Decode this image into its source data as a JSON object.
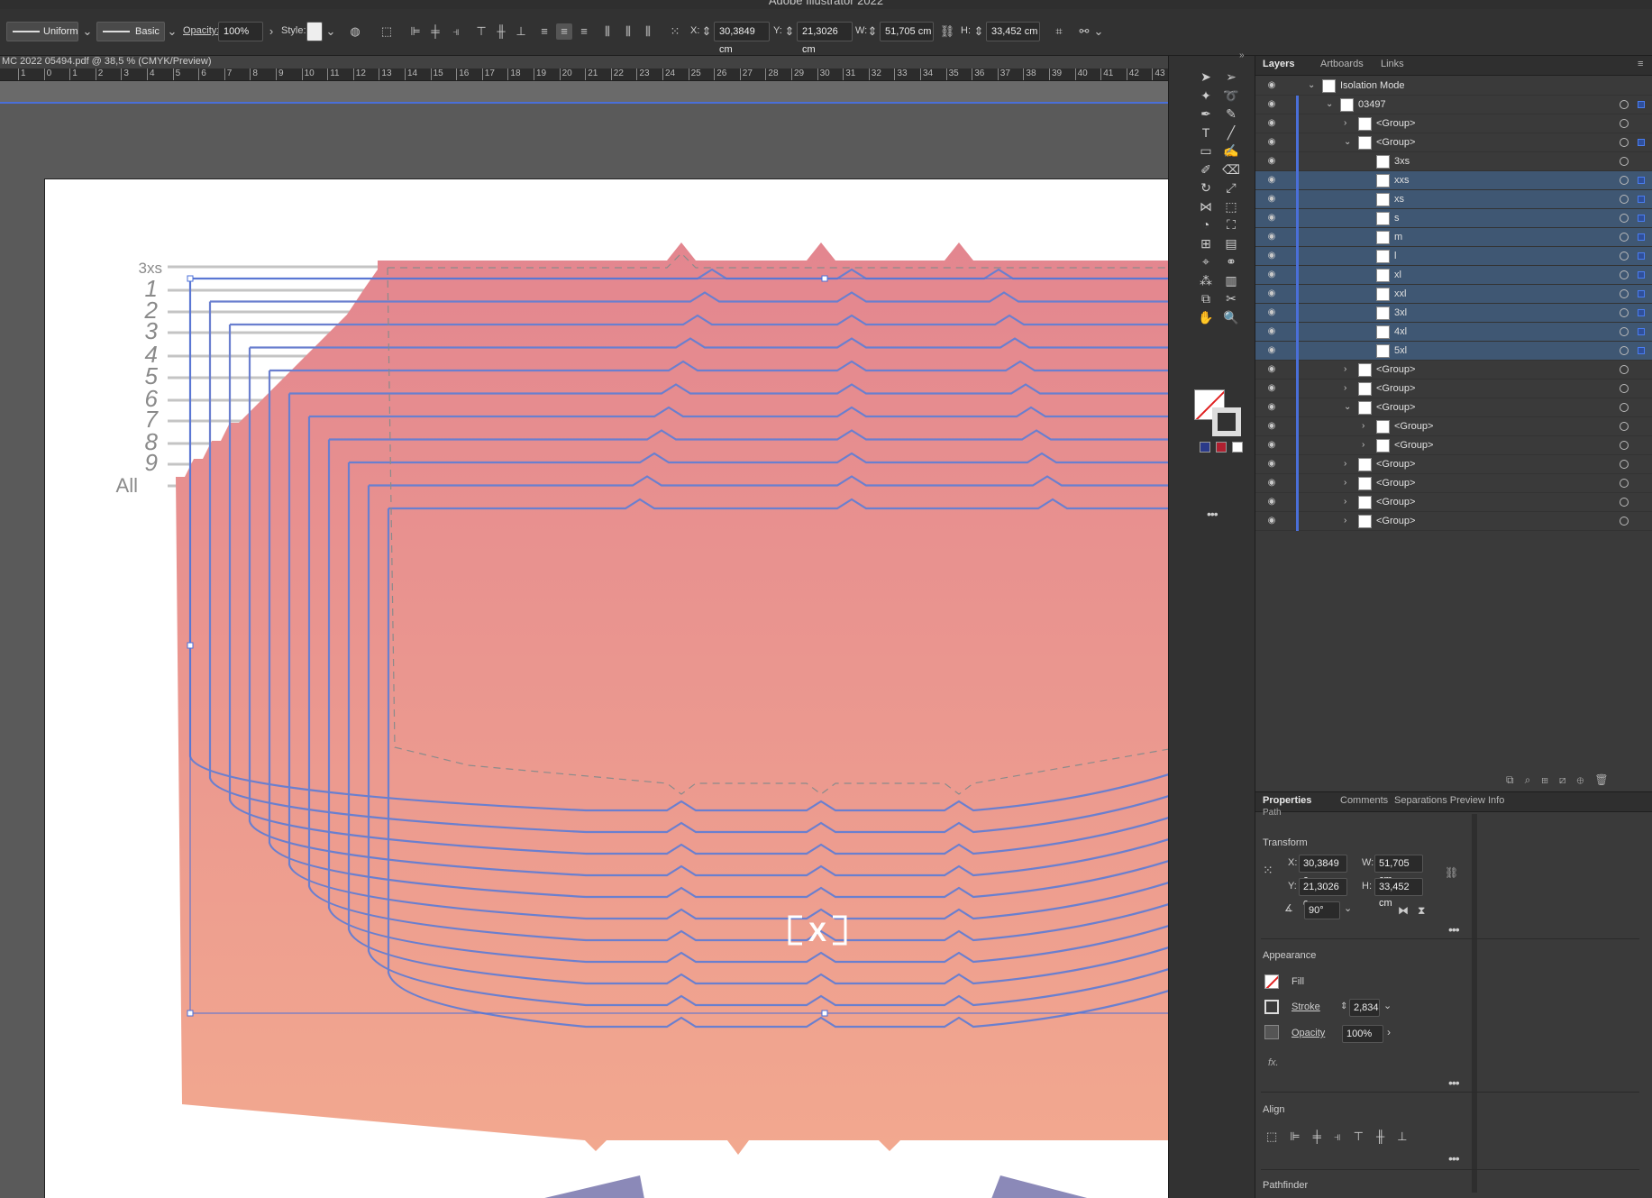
{
  "app": {
    "title": "Adobe Illustrator 2022"
  },
  "control_bar": {
    "stroke_profile": "Uniform",
    "brush": "Basic",
    "opacity_label": "Opacity:",
    "opacity_value": "100%",
    "style_label": "Style:",
    "x_label": "X:",
    "x_value": "30,3849 cm",
    "y_label": "Y:",
    "y_value": "21,3026 cm",
    "w_label": "W:",
    "w_value": "51,705 cm",
    "h_label": "H:",
    "h_value": "33,452 cm"
  },
  "document": {
    "tab_title": "MC 2022 05494.pdf @ 38,5 % (CMYK/Preview)",
    "ruler_ticks": [
      "1",
      "0",
      "1",
      "2",
      "3",
      "4",
      "5",
      "6",
      "7",
      "8",
      "9",
      "10",
      "11",
      "12",
      "13",
      "14",
      "15",
      "16",
      "17",
      "18",
      "19",
      "20",
      "21",
      "22",
      "23",
      "24",
      "25",
      "26",
      "27",
      "28",
      "29",
      "30",
      "31",
      "32",
      "33",
      "34",
      "35",
      "36",
      "37",
      "38",
      "39",
      "40",
      "41",
      "42",
      "43"
    ],
    "size_labels": [
      "3xs",
      "1",
      "2",
      "3",
      "4",
      "5",
      "6",
      "7",
      "8",
      "9",
      "All"
    ],
    "badge": "[X]"
  },
  "layers_panel": {
    "tabs": [
      "Layers",
      "Artboards",
      "Links"
    ],
    "rows": [
      {
        "name": "Isolation Mode",
        "indent": 0,
        "chev": "v",
        "sel": false
      },
      {
        "name": "03497",
        "indent": 1,
        "chev": "v",
        "sel": false
      },
      {
        "name": "<Group>",
        "indent": 2,
        "chev": ">",
        "sel": false
      },
      {
        "name": "<Group>",
        "indent": 2,
        "chev": "v",
        "sel": false
      },
      {
        "name": "3xs",
        "indent": 3,
        "chev": "",
        "sel": false
      },
      {
        "name": "xxs",
        "indent": 3,
        "chev": "",
        "sel": true
      },
      {
        "name": "xs",
        "indent": 3,
        "chev": "",
        "sel": true
      },
      {
        "name": "s",
        "indent": 3,
        "chev": "",
        "sel": true
      },
      {
        "name": "m",
        "indent": 3,
        "chev": "",
        "sel": true
      },
      {
        "name": "l",
        "indent": 3,
        "chev": "",
        "sel": true
      },
      {
        "name": "xl",
        "indent": 3,
        "chev": "",
        "sel": true
      },
      {
        "name": "xxl",
        "indent": 3,
        "chev": "",
        "sel": true
      },
      {
        "name": "3xl",
        "indent": 3,
        "chev": "",
        "sel": true
      },
      {
        "name": "4xl",
        "indent": 3,
        "chev": "",
        "sel": true
      },
      {
        "name": "5xl",
        "indent": 3,
        "chev": "",
        "sel": true
      },
      {
        "name": "<Group>",
        "indent": 2,
        "chev": ">",
        "sel": false
      },
      {
        "name": "<Group>",
        "indent": 2,
        "chev": ">",
        "sel": false
      },
      {
        "name": "<Group>",
        "indent": 2,
        "chev": "v",
        "sel": false
      },
      {
        "name": "<Group>",
        "indent": 3,
        "chev": ">",
        "sel": false
      },
      {
        "name": "<Group>",
        "indent": 3,
        "chev": ">",
        "sel": false
      },
      {
        "name": "<Group>",
        "indent": 2,
        "chev": ">",
        "sel": false
      },
      {
        "name": "<Group>",
        "indent": 2,
        "chev": ">",
        "sel": false
      },
      {
        "name": "<Group>",
        "indent": 2,
        "chev": ">",
        "sel": false
      },
      {
        "name": "<Group>",
        "indent": 2,
        "chev": ">",
        "sel": false
      }
    ]
  },
  "properties_panel": {
    "tabs": [
      "Properties",
      "Comments",
      "Separations Preview",
      "Info"
    ],
    "object_kind": "Path",
    "transform_title": "Transform",
    "x_label": "X:",
    "x_value": "30,3849 c",
    "y_label": "Y:",
    "y_value": "21,3026 c",
    "w_label": "W:",
    "w_value": "51,705 cm",
    "h_label": "H:",
    "h_value": "33,452 cm",
    "angle_value": "90°",
    "appearance_title": "Appearance",
    "fill_label": "Fill",
    "stroke_label": "Stroke",
    "stroke_value": "2,834",
    "opacity_label": "Opacity",
    "opacity_value": "100%",
    "fx_label": "fx.",
    "align_title": "Align",
    "pathfinder_title": "Pathfinder"
  },
  "colors": {
    "accent": "#4a6fd8",
    "selection": "#3f5773",
    "pink_top": "#e3868f",
    "pink_bottom": "#f2a88f",
    "pattern_line": "#6a7fcf"
  }
}
